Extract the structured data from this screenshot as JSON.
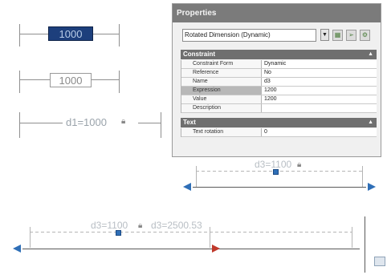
{
  "canvas": {
    "dim_selected": "1000",
    "dim_editing": "1000",
    "label_d1": "d1=1000",
    "label_upper": "d3=1100",
    "label_lower_a": "d3=1100",
    "label_lower_b": "d3=2500.53"
  },
  "palette": {
    "title": "Properties",
    "object_type": "Rotated Dimension (Dynamic)",
    "sections": {
      "constraint": {
        "title": "Constraint",
        "rows": [
          {
            "key": "Constraint Form",
            "value": "Dynamic"
          },
          {
            "key": "Reference",
            "value": "No"
          },
          {
            "key": "Name",
            "value": "d3"
          },
          {
            "key": "Expression",
            "value": "1200"
          },
          {
            "key": "Value",
            "value": "1200"
          },
          {
            "key": "Description",
            "value": ""
          }
        ]
      },
      "text": {
        "title": "Text",
        "rows": [
          {
            "key": "Text rotation",
            "value": "0"
          }
        ]
      }
    }
  },
  "colors": {
    "accent": "#2f6fb7",
    "selected_dim_bg": "#1d3f7c",
    "palette_title_bg": "#7b7b7b",
    "marker_red": "#c0392b"
  }
}
